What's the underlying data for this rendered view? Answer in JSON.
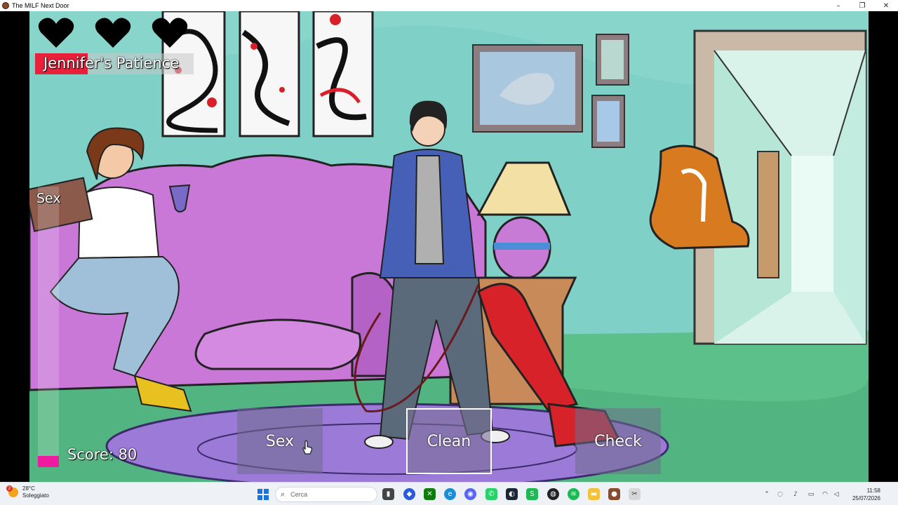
{
  "window": {
    "title": "The MILF Next Door",
    "minimize_glyph": "–",
    "maximize_glyph": "❐",
    "close_glyph": "✕"
  },
  "hud": {
    "hearts_remaining": 3,
    "patience_label": "Jennifer's Patience",
    "patience_level": 0.33,
    "sex_meter_label": "Sex",
    "sex_meter_level": 0.04,
    "score_text": "Score: 80"
  },
  "actions": [
    {
      "label": "Sex",
      "selected": false
    },
    {
      "label": "Clean",
      "selected": true
    },
    {
      "label": "Check",
      "selected": false
    }
  ],
  "taskbar": {
    "weather_temp": "28°C",
    "weather_desc": "Soleggiato",
    "weather_badge": "2",
    "search_placeholder": "Cerca",
    "clock_time": "11:58",
    "clock_date": "25/07/2026",
    "icons": [
      "file-explorer-icon",
      "copilot-icon",
      "xbox-icon",
      "edge-icon",
      "discord-icon",
      "whatsapp-icon",
      "steam-icon",
      "spotify-icon",
      "games-icon",
      "spotify-app-icon",
      "folder-icon",
      "game-app-icon",
      "snipping-icon"
    ]
  },
  "colors": {
    "patience_fill": "#e8203a",
    "sex_meter_fill": "#ee1aa0",
    "wall": "#7fd0c7",
    "couch": "#c978d8",
    "rug": "#9b7ad8"
  }
}
